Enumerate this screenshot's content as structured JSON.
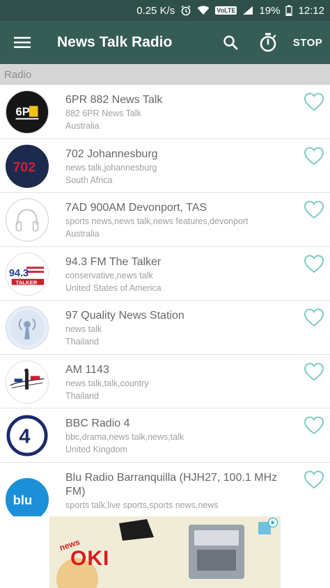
{
  "status_bar": {
    "net_speed": "0.25 K/s",
    "volte": "VoLTE",
    "battery": "19%",
    "time": "12:12"
  },
  "toolbar": {
    "title": "News Talk Radio",
    "stop_label": "STOP"
  },
  "section": {
    "label": "Radio"
  },
  "stations": [
    {
      "name": "6PR 882 News Talk",
      "tags": "882 6PR News Talk",
      "country": "Australia",
      "logo": "6pr-logo"
    },
    {
      "name": "702 Johannesburg",
      "tags": "news talk,johannesburg",
      "country": "South Africa",
      "logo": "702-logo"
    },
    {
      "name": "7AD 900AM Devonport, TAS",
      "tags": "sports news,news talk,news features,devonport",
      "country": "Australia",
      "logo": "headphones-placeholder"
    },
    {
      "name": "94.3 FM The Talker",
      "tags": "conservative,news talk",
      "country": "United States of America",
      "logo": "943-talker-logo"
    },
    {
      "name": "97 Quality News Station",
      "tags": "news talk",
      "country": "Thailand",
      "logo": "radio-tower-logo"
    },
    {
      "name": "AM 1143",
      "tags": "news talk,talk,country",
      "country": "Thailand",
      "logo": "am1143-logo"
    },
    {
      "name": "BBC Radio 4",
      "tags": "bbc,drama,news talk,news,talk",
      "country": "United Kingdom",
      "logo": "bbc-radio4-logo"
    },
    {
      "name": "Blu Radio Barranquilla (HJH27, 100.1 MHz FM)",
      "tags": "sports talk,live sports,sports news,news",
      "country": "",
      "logo": "blu-logo"
    }
  ],
  "ad": {
    "brand": "OKI",
    "tagline": "news"
  },
  "colors": {
    "status_bar": "#2f4f4a",
    "toolbar": "#365c56",
    "heart": "#7fc9c4",
    "section_header": "#d6d6d6"
  }
}
